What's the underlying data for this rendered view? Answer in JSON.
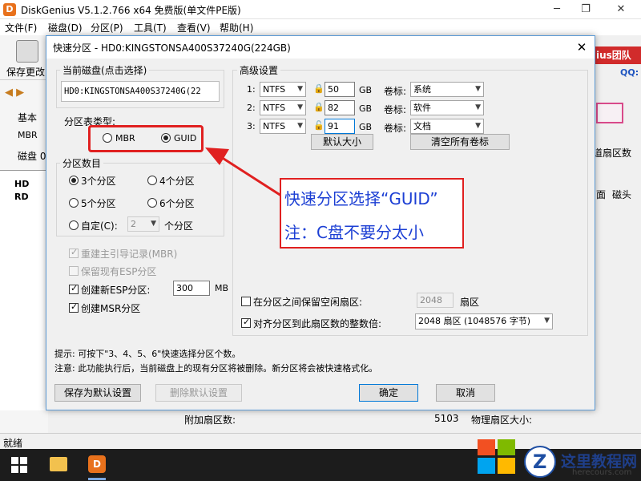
{
  "app": {
    "title": "DiskGenius V5.1.2.766 x64 免费版(单文件PE版)",
    "logo": "D",
    "menu": [
      "文件(F)",
      "磁盘(D)",
      "分区(P)",
      "工具(T)",
      "查看(V)",
      "帮助(H)"
    ],
    "toolbar_save": "保存更改",
    "left_items": [
      "基本",
      "MBR",
      "磁盘 0"
    ],
    "tree_items": [
      "HD",
      "RD"
    ],
    "right_texts": [
      "ius团队",
      "QQ:",
      "道扇区数",
      "面",
      "磁头"
    ],
    "bottom_rows": [
      {
        "label": "附加扇区数:",
        "value": "5103",
        "label2": "物理扇区大小:"
      }
    ],
    "status": "就绪"
  },
  "dialog": {
    "title": "快速分区 - HD0:KINGSTONSA400S37240G(224GB)",
    "close": "✕",
    "current_disk": {
      "label": "当前磁盘(点击选择)",
      "value": "HD0:KINGSTONSA400S37240G(22"
    },
    "partition_table": {
      "label": "分区表类型:",
      "options": [
        "MBR",
        "GUID"
      ],
      "selected": "GUID"
    },
    "partition_count": {
      "label": "分区数目",
      "options": [
        "3个分区",
        "4个分区",
        "5个分区",
        "6个分区"
      ],
      "selected": "3个分区",
      "custom_label": "自定(C):",
      "custom_value": "2",
      "custom_suffix": "个分区"
    },
    "options": {
      "rebuild_mbr": "重建主引导记录(MBR)",
      "keep_esp": "保留现有ESP分区",
      "create_esp": "创建新ESP分区:",
      "esp_size": "300",
      "esp_unit": "MB",
      "create_msr": "创建MSR分区"
    },
    "advanced": {
      "label": "高级设置",
      "rows": [
        {
          "index": "1:",
          "fs": "NTFS",
          "size": "50",
          "unit": "GB",
          "vol_label_text": "卷标:",
          "volume": "系统",
          "locked": true
        },
        {
          "index": "2:",
          "fs": "NTFS",
          "size": "82",
          "unit": "GB",
          "vol_label_text": "卷标:",
          "volume": "软件",
          "locked": true
        },
        {
          "index": "3:",
          "fs": "NTFS",
          "size": "91",
          "unit": "GB",
          "vol_label_text": "卷标:",
          "volume": "文档",
          "locked": false
        }
      ],
      "default_size_btn": "默认大小",
      "clear_labels_btn": "清空所有卷标",
      "reserve_label": "在分区之间保留空闲扇区:",
      "reserve_value": "2048",
      "reserve_unit": "扇区",
      "align_label": "对齐分区到此扇区数的整数倍:",
      "align_value": "2048 扇区 (1048576 字节)"
    },
    "hint1": "提示: 可按下\"3、4、5、6\"快速选择分区个数。",
    "hint2": "注意: 此功能执行后，当前磁盘上的现有分区将被删除。新分区将会被快速格式化。",
    "buttons": {
      "save_default": "保存为默认设置",
      "delete_default": "删除默认设置",
      "ok": "确定",
      "cancel": "取消"
    }
  },
  "annotation": {
    "line1": "快速分区选择“GUID”",
    "line2": "注：C盘不要分太小",
    "color": "#e02020",
    "text_color": "#1c3fd4"
  },
  "watermark": {
    "site_cn": "这里教程网",
    "site_url": "herecours.com"
  }
}
